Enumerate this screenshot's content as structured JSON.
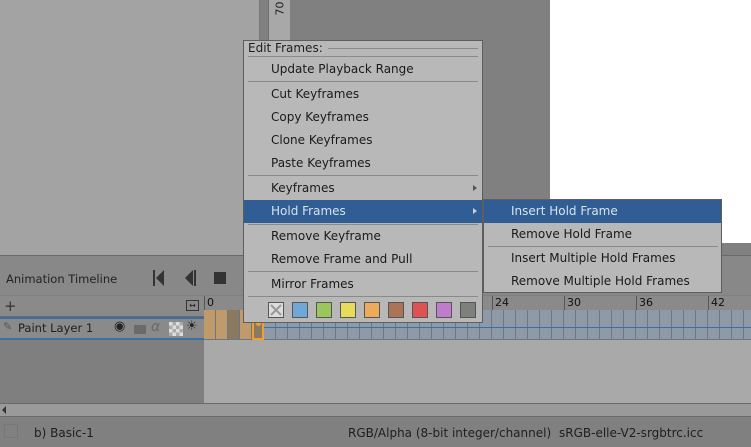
{
  "canvas": {
    "ruler_label": "70"
  },
  "timeline": {
    "title": "Animation Timeline",
    "layer_name": "Paint Layer 1",
    "ruler_ticks": [
      "0",
      "24",
      "30",
      "36",
      "42"
    ],
    "frames": {
      "filled": [
        0,
        1,
        2,
        3
      ],
      "keyframe": 4,
      "filled_color": "#c09a6a",
      "empty_color": "#8e9aa8",
      "keyframe_color": "#f0a030"
    }
  },
  "menu": {
    "header": "Edit Frames:",
    "items": [
      "Update Playback Range",
      "Cut Keyframes",
      "Copy Keyframes",
      "Clone Keyframes",
      "Paste Keyframes",
      "Keyframes",
      "Hold Frames",
      "Remove Keyframe",
      "Remove Frame and Pull",
      "Mirror Frames"
    ],
    "highlighted": "Hold Frames",
    "swatches": [
      "none",
      "#6fa8d6",
      "#9cc65c",
      "#e6dc5a",
      "#eeaa5a",
      "#ab7456",
      "#e05252",
      "#c07ccc",
      "#7e807c"
    ]
  },
  "submenu": {
    "items": [
      "Insert Hold Frame",
      "Remove Hold Frame",
      "Insert Multiple Hold Frames",
      "Remove Multiple Hold Frames"
    ]
  },
  "status": {
    "brush": "b) Basic-1",
    "color_model": "RGB/Alpha (8-bit integer/channel)",
    "profile": "sRGB-elle-V2-srgbtrc.icc"
  }
}
